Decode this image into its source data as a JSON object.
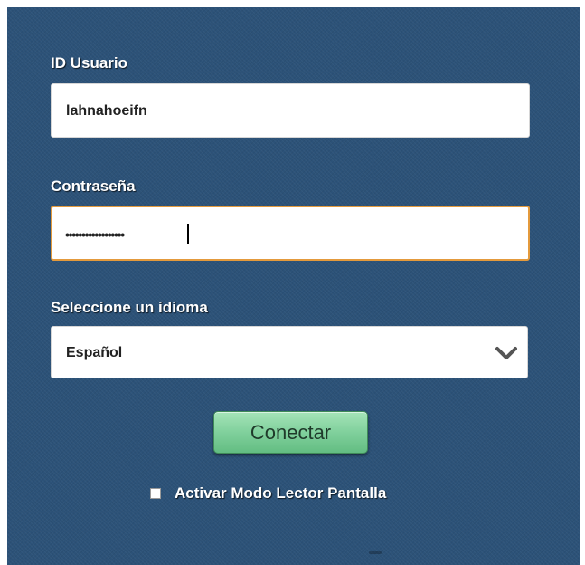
{
  "login": {
    "user_label": "ID Usuario",
    "user_value": "lahnahoeifn",
    "password_label": "Contraseña",
    "password_dots": "••••••••••••••••••",
    "language_label": "Seleccione un idioma",
    "language_selected": "Español",
    "connect_label": "Conectar",
    "screen_reader_label": "Activar Modo Lector Pantalla"
  },
  "icons": {
    "dropdown": "chevron-down-icon"
  },
  "colors": {
    "panel_bg": "#2c5278",
    "focus_border": "#e49a3c",
    "button_green": "#80d09c"
  }
}
